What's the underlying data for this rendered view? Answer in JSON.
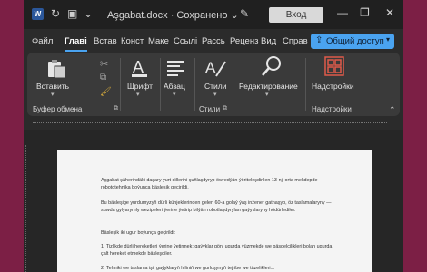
{
  "titlebar": {
    "doc_title": "Aşgabat.docx  ·  Сохранено  ⌄",
    "login": "Вход",
    "minimize": "—",
    "restore": "❐",
    "close": "✕"
  },
  "tabs": [
    "Файл",
    "Главі",
    "Встав",
    "Конст",
    "Маке",
    "Ссылі",
    "Рассь",
    "Реценз",
    "Вид",
    "Справ"
  ],
  "share": {
    "label": "Общий доступ",
    "icon": "share-icon"
  },
  "ribbon": {
    "paste": "Вставить",
    "clipboard_group": "Буфер обмена",
    "font": "Шрифт",
    "paragraph": "Абзац",
    "styles": "Стили",
    "styles_group": "Стили",
    "editing": "Редактирование",
    "addins": "Надстройки",
    "addins_group": "Надстройки"
  },
  "document": {
    "paragraphs": [
      "Aşgabat şäherindäki daşary yurt dillerini çuňlaşdyryp öwredýän ýöriteleşdirilen 13-nji orta mekdepde robototehnika boýunça bäsleşik geçirildi.",
      "Bu bäsleşige yurdumyzyň dürli künjeklerinden gelen 60-a golaý ýaş inžener gatnaşyp, öz taslamalaryny — suwda gylýarymly wezipeleri ýerine ýetirip bilýän robotlaşdyrylan gaýyklaryny hödürlediler.",
      "Bäsleşik iki ugur boýunça geçirildi:",
      "1. Tizlikde dürli hereketleri ýerine ýetirmek: gaýyklar göni ugurda ýüzmekde we päsgelçilikleri bolan ugurda çalt hereket etmekde bäsleşdiler.",
      "2. Tehniki we taslama işi: gaýyklaryň hiliniň we gurluşynyň tejribe we täzelikleri..."
    ]
  },
  "colors": {
    "window_bg": "#2b2b2b",
    "accent": "#4aa3f0",
    "desktop": "#7c1f45"
  }
}
